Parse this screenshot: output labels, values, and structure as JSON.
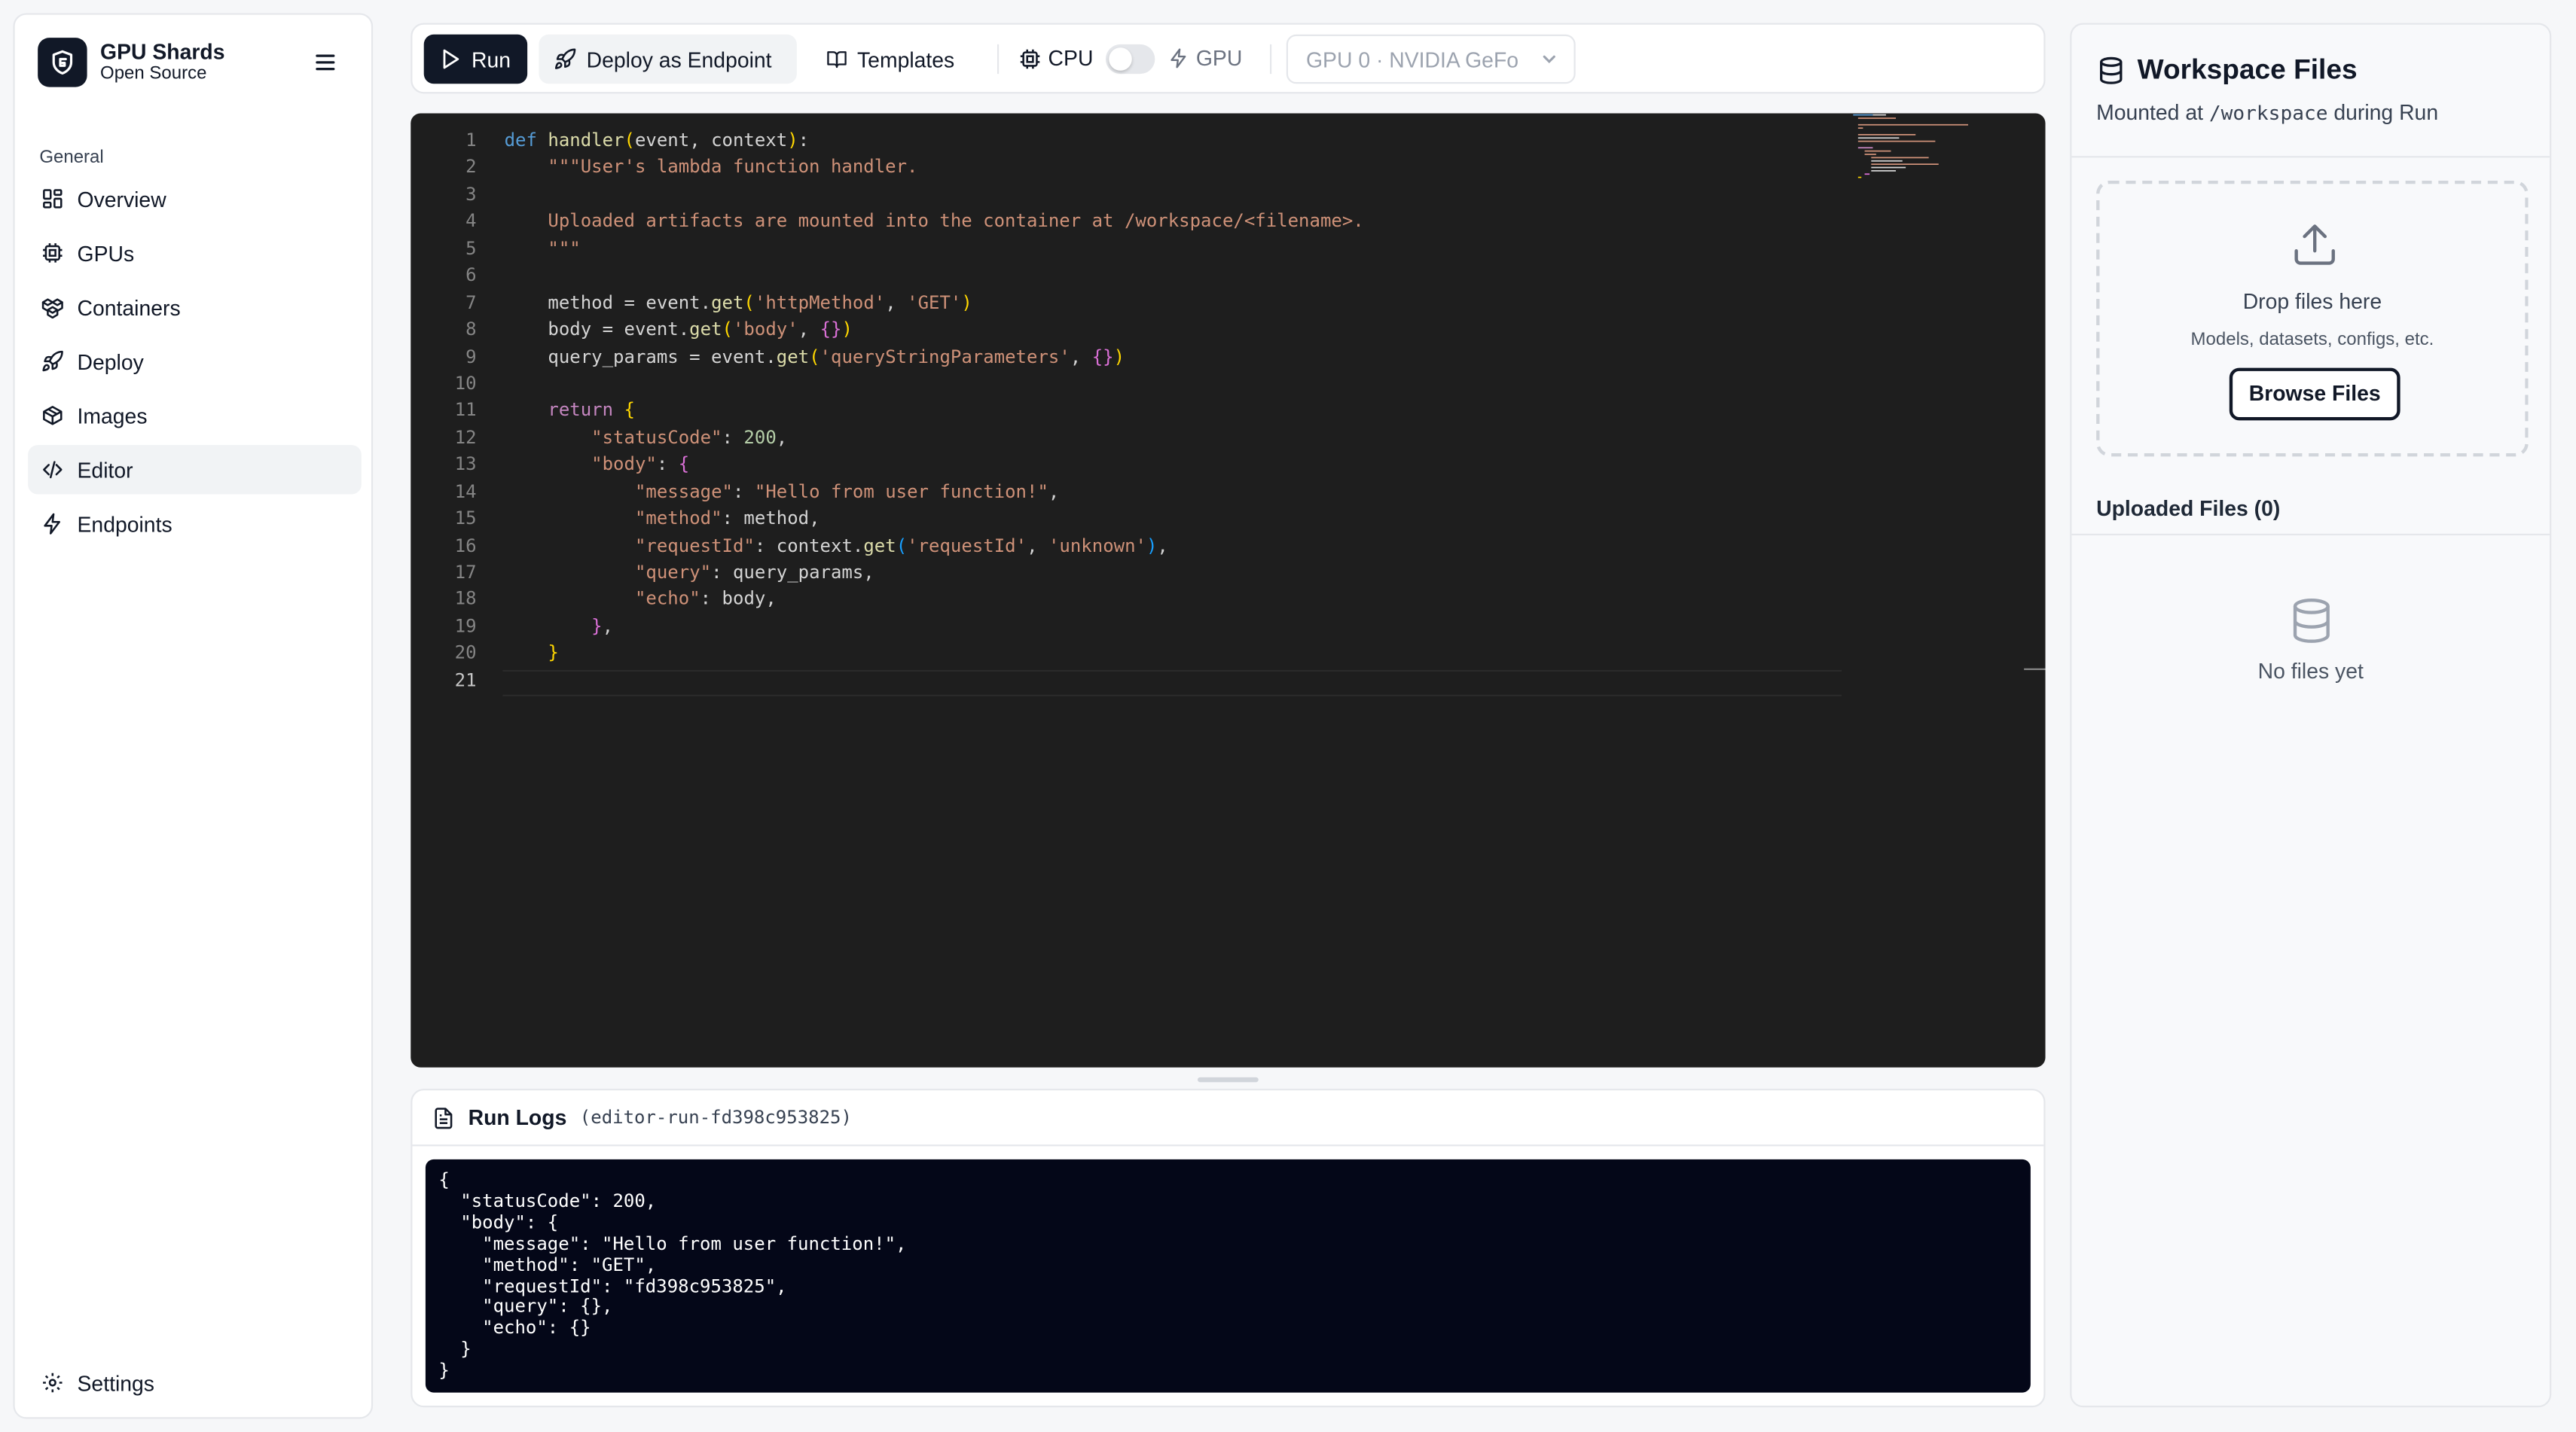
{
  "brand": {
    "title": "GPU Shards",
    "subtitle": "Open Source"
  },
  "sidebar": {
    "section_label": "General",
    "items": [
      {
        "label": "Overview",
        "icon": "grid-icon",
        "active": false
      },
      {
        "label": "GPUs",
        "icon": "chip-icon",
        "active": false
      },
      {
        "label": "Containers",
        "icon": "boxes-icon",
        "active": false
      },
      {
        "label": "Deploy",
        "icon": "rocket-icon",
        "active": false
      },
      {
        "label": "Images",
        "icon": "package-icon",
        "active": false
      },
      {
        "label": "Editor",
        "icon": "code-icon",
        "active": true
      },
      {
        "label": "Endpoints",
        "icon": "zap-icon",
        "active": false
      }
    ],
    "settings_label": "Settings"
  },
  "toolbar": {
    "run_label": "Run",
    "deploy_label": "Deploy as Endpoint",
    "templates_label": "Templates",
    "cpu_label": "CPU",
    "gpu_label": "GPU",
    "device_select_value": "GPU 0 · NVIDIA GeFo"
  },
  "editor": {
    "active_line": 21,
    "lines": [
      "def handler(event, context):",
      "    \"\"\"User's lambda function handler.",
      "",
      "    Uploaded artifacts are mounted into the container at /workspace/<filename>.",
      "    \"\"\"",
      "",
      "    method = event.get('httpMethod', 'GET')",
      "    body = event.get('body', {})",
      "    query_params = event.get('queryStringParameters', {})",
      "",
      "    return {",
      "        \"statusCode\": 200,",
      "        \"body\": {",
      "            \"message\": \"Hello from user function!\",",
      "            \"method\": method,",
      "            \"requestId\": context.get('requestId', 'unknown'),",
      "            \"query\": query_params,",
      "            \"echo\": body,",
      "        },",
      "    }",
      ""
    ]
  },
  "logs": {
    "title": "Run Logs",
    "run_id": "(editor-run-fd398c953825)",
    "output": "{\n  \"statusCode\": 200,\n  \"body\": {\n    \"message\": \"Hello from user function!\",\n    \"method\": \"GET\",\n    \"requestId\": \"fd398c953825\",\n    \"query\": {},\n    \"echo\": {}\n  }\n}"
  },
  "workspace": {
    "title": "Workspace Files",
    "subtitle_prefix": "Mounted at",
    "subtitle_path": "/workspace",
    "subtitle_suffix": "during Run",
    "drop_title": "Drop files here",
    "drop_hint": "Models, datasets, configs, etc.",
    "browse_label": "Browse Files",
    "uploaded_label": "Uploaded Files (0)",
    "empty_text": "No files yet"
  },
  "colors": {
    "accent_dark": "#111827",
    "editor_bg": "#1e1e1e",
    "logs_bg": "#040718"
  }
}
